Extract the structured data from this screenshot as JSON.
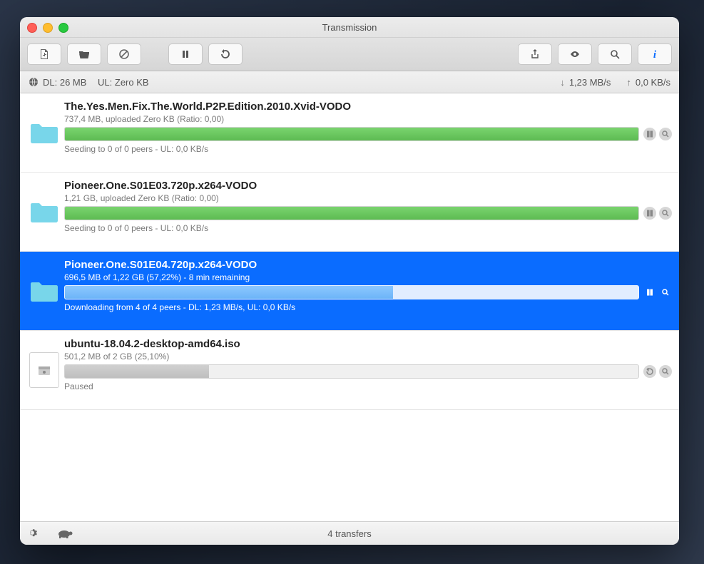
{
  "window": {
    "title": "Transmission"
  },
  "statsbar": {
    "dl_label": "DL: 26 MB",
    "ul_label": "UL: Zero KB",
    "dl_rate": "1,23 MB/s",
    "ul_rate": "0,0 KB/s"
  },
  "transfers": [
    {
      "name": "The.Yes.Men.Fix.The.World.P2P.Edition.2010.Xvid-VODO",
      "line1": "737,4 MB, uploaded Zero KB (Ratio: 0,00)",
      "line2": "Seeding to 0 of 0 peers - UL: 0,0 KB/s",
      "progressPct": 100,
      "barColor": "green",
      "icon": "folder",
      "selected": false,
      "action": "pause"
    },
    {
      "name": "Pioneer.One.S01E03.720p.x264-VODO",
      "line1": "1,21 GB, uploaded Zero KB (Ratio: 0,00)",
      "line2": "Seeding to 0 of 0 peers - UL: 0,0 KB/s",
      "progressPct": 100,
      "barColor": "green",
      "icon": "folder",
      "selected": false,
      "action": "pause"
    },
    {
      "name": "Pioneer.One.S01E04.720p.x264-VODO",
      "line1": "696,5 MB of 1,22 GB (57,22%) - 8 min remaining",
      "line2": "Downloading from 4 of 4 peers - DL: 1,23 MB/s, UL: 0,0 KB/s",
      "progressPct": 57.22,
      "barColor": "blue",
      "icon": "folder",
      "selected": true,
      "action": "pause"
    },
    {
      "name": "ubuntu-18.04.2-desktop-amd64.iso",
      "line1": "501,2 MB of 2 GB (25,10%)",
      "line2": "Paused",
      "progressPct": 25.1,
      "barColor": "grey",
      "icon": "iso",
      "selected": false,
      "action": "resume"
    }
  ],
  "footer": {
    "count_label": "4 transfers"
  }
}
